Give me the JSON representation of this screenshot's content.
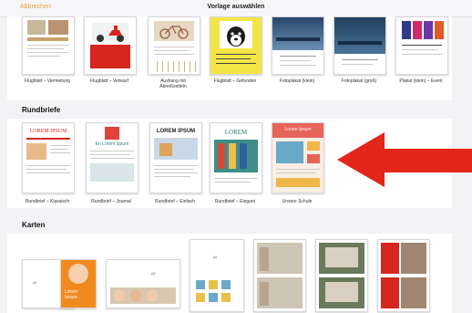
{
  "header": {
    "cancel_label": "Abbrechen",
    "title": "Vorlage auswählen"
  },
  "sections": {
    "flyers": {
      "items": [
        {
          "caption": "Flugblatt – Vermietung"
        },
        {
          "caption": "Flugblatt – Verkauf"
        },
        {
          "caption": "Aushang mit\nAbreißzetteln"
        },
        {
          "caption": "Flugblatt – Gefunden"
        },
        {
          "caption": "Fotoplakat (klein)"
        },
        {
          "caption": "Fotoplakat (groß)"
        },
        {
          "caption": "Plakat (klein) – Event"
        }
      ]
    },
    "newsletters": {
      "title": "Rundbriefe",
      "items": [
        {
          "caption": "Rundbrief – Klassisch",
          "headline": "LOREM IPSUM"
        },
        {
          "caption": "Rundbrief – Journal",
          "headline": "En Lorem Ipsum"
        },
        {
          "caption": "Rundbrief – Einfach",
          "headline": "LOREM IPSUM"
        },
        {
          "caption": "Rundbrief – Elegant",
          "headline": "LOREM"
        },
        {
          "caption": "Unsere Schule",
          "headline": "Lorem Ipsum"
        }
      ]
    },
    "cards": {
      "title": "Karten",
      "items": [
        {
          "label": "Lorem\nIpsum"
        },
        {
          "label": ""
        },
        {
          "label": ""
        },
        {
          "label": ""
        },
        {
          "label": ""
        },
        {
          "label": ""
        }
      ]
    }
  },
  "colors": {
    "accent": "#e9a13b",
    "arrow": "#e3261a"
  }
}
